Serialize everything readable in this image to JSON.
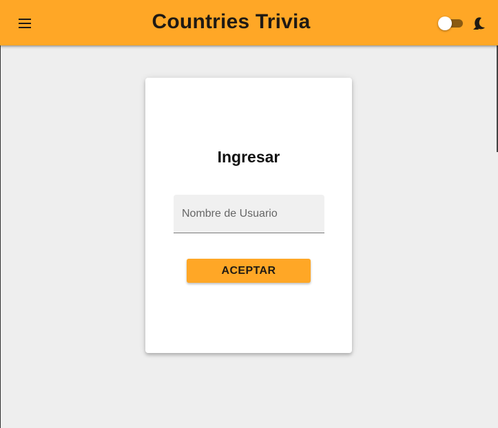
{
  "appbar": {
    "title": "Countries Trivia",
    "menu_icon": "hamburger-menu-icon",
    "theme_toggle": {
      "state": "off",
      "icon": "moon-icon"
    },
    "background_color": "#ffa726"
  },
  "login_card": {
    "title": "Ingresar",
    "username_field": {
      "placeholder": "Nombre de Usuario",
      "value": ""
    },
    "accept_button_label": "ACEPTAR"
  },
  "colors": {
    "accent": "#ffa726",
    "page_background": "#eeeeee",
    "card_background": "#ffffff",
    "toggle_track": "#8a5a12"
  }
}
